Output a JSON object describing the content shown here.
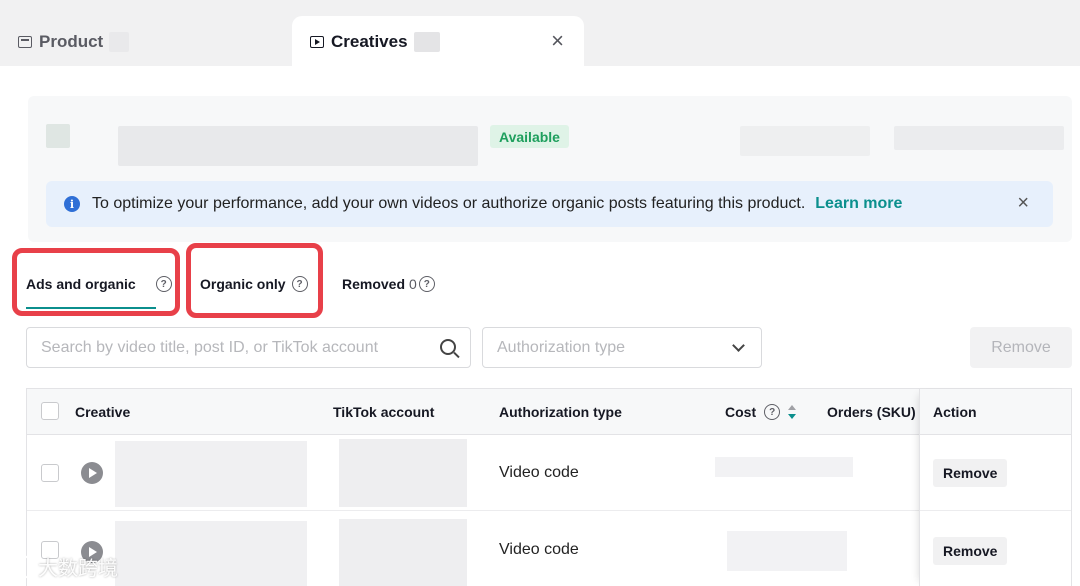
{
  "top_tabs": {
    "product_label": "Product",
    "creatives_label": "Creatives",
    "close_symbol": "×"
  },
  "header": {
    "status_badge": "Available"
  },
  "banner": {
    "message": "To optimize your performance, add your own videos or authorize organic posts featuring this product.",
    "link_text": "Learn more",
    "close_symbol": "×",
    "info_symbol": "i"
  },
  "sub_tabs": {
    "ads_and_organic": "Ads and organic",
    "organic_only": "Organic only",
    "removed_label": "Removed",
    "removed_count": "0",
    "help_symbol": "?"
  },
  "filters": {
    "search_placeholder": "Search by video title, post ID, or TikTok account",
    "authorization_placeholder": "Authorization type",
    "remove_button": "Remove"
  },
  "table": {
    "headers": {
      "creative": "Creative",
      "tiktok_account": "TikTok account",
      "authorization_type": "Authorization type",
      "cost": "Cost",
      "orders": "Orders (SKU)",
      "action": "Action"
    },
    "rows": [
      {
        "authorization_type": "Video code",
        "action": "Remove"
      },
      {
        "authorization_type": "Video code",
        "action": "Remove"
      }
    ]
  },
  "watermark": "大数跨境",
  "colors": {
    "accent": "#0b8f8d",
    "highlight": "#e84049",
    "badge_bg": "#dff3e7",
    "badge_text": "#1e9f5d",
    "banner_bg": "#e7f0fc"
  }
}
